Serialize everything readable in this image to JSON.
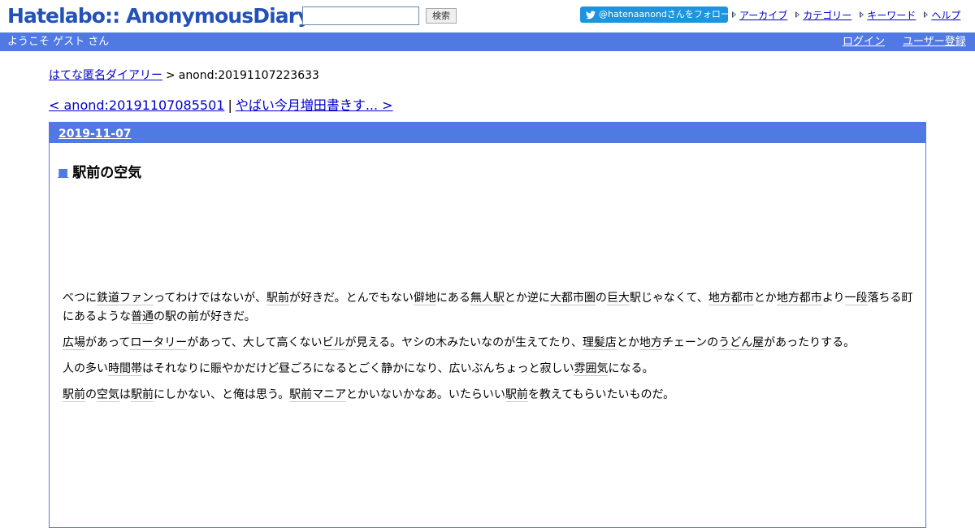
{
  "header": {
    "logo": "Hatelabo:: AnonymousDiary",
    "search_placeholder": "",
    "search_button": "検索",
    "follow_label": "@hatenaanondさんをフォロー",
    "links": [
      {
        "label": "アーカイブ"
      },
      {
        "label": "カテゴリー"
      },
      {
        "label": "キーワード"
      },
      {
        "label": "ヘルプ"
      }
    ]
  },
  "userbar": {
    "welcome": "ようこそ ゲスト さん",
    "login": "ログイン",
    "register": "ユーザー登録"
  },
  "breadcrumb": {
    "home": "はてな匿名ダイアリー",
    "separator": ">",
    "current": "anond:20191107223633"
  },
  "pager": {
    "prev": "< anond:20191107085501",
    "separator": "|",
    "next": "やばい今月増田書きす... >"
  },
  "day": {
    "date": "2019-11-07",
    "title_marker": "■",
    "title": "駅前の空気"
  },
  "body": {
    "paragraphs": [
      [
        {
          "t": "べつに"
        },
        {
          "t": "鉄道ファン",
          "k": true
        },
        {
          "t": "ってわけではないが、"
        },
        {
          "t": "駅前",
          "k": true
        },
        {
          "t": "が好きだ。とんでもない"
        },
        {
          "t": "僻地",
          "k": true
        },
        {
          "t": "にある"
        },
        {
          "t": "無人駅",
          "k": true
        },
        {
          "t": "とか逆に"
        },
        {
          "t": "大都市圏",
          "k": true
        },
        {
          "t": "の"
        },
        {
          "t": "巨大",
          "k": true
        },
        {
          "t": "駅じゃなくて、"
        },
        {
          "t": "地方都市",
          "k": true
        },
        {
          "t": "とか"
        },
        {
          "t": "地方都市",
          "k": true
        },
        {
          "t": "より"
        },
        {
          "t": "一段",
          "k": true
        },
        {
          "t": "落ちる町にあるような"
        },
        {
          "t": "普通",
          "k": true
        },
        {
          "t": "の駅の前が好きだ。"
        }
      ],
      [
        {
          "t": "広場",
          "k": true
        },
        {
          "t": "があって"
        },
        {
          "t": "ロータリー",
          "k": true
        },
        {
          "t": "があって、大して高くない"
        },
        {
          "t": "ビル",
          "k": true
        },
        {
          "t": "が見える。ヤシの木みたいなのが生えてたり、"
        },
        {
          "t": "理髪店",
          "k": true
        },
        {
          "t": "とか"
        },
        {
          "t": "地方",
          "k": true
        },
        {
          "t": "チェーンの"
        },
        {
          "t": "うどん屋",
          "k": true
        },
        {
          "t": "があったりする。"
        }
      ],
      [
        {
          "t": "人の多い"
        },
        {
          "t": "時間帯",
          "k": true
        },
        {
          "t": "はそれなりに賑やかだけど昼ごろになるとごく静かになり、広いぶんちょっと寂しい"
        },
        {
          "t": "雰囲気",
          "k": true
        },
        {
          "t": "になる。"
        }
      ],
      [
        {
          "t": "駅前",
          "k": true
        },
        {
          "t": "の"
        },
        {
          "t": "空気",
          "k": true
        },
        {
          "t": "は"
        },
        {
          "t": "駅前",
          "k": true
        },
        {
          "t": "にしかない、と俺は思う。"
        },
        {
          "t": "駅前",
          "k": true
        },
        {
          "t": "マニア",
          "k": true
        },
        {
          "t": "とかいないかなあ。いたらいい"
        },
        {
          "t": "駅前",
          "k": true
        },
        {
          "t": "を教えてもらいたいものだ。"
        }
      ]
    ]
  },
  "colors": {
    "brand": "#2451b8",
    "bar": "#5079e3",
    "twitter": "#1b95e0",
    "link": "#0000cc"
  },
  "icons": {
    "follow": "twitter-bird-icon",
    "link_marker": "chevron-right-icon"
  }
}
